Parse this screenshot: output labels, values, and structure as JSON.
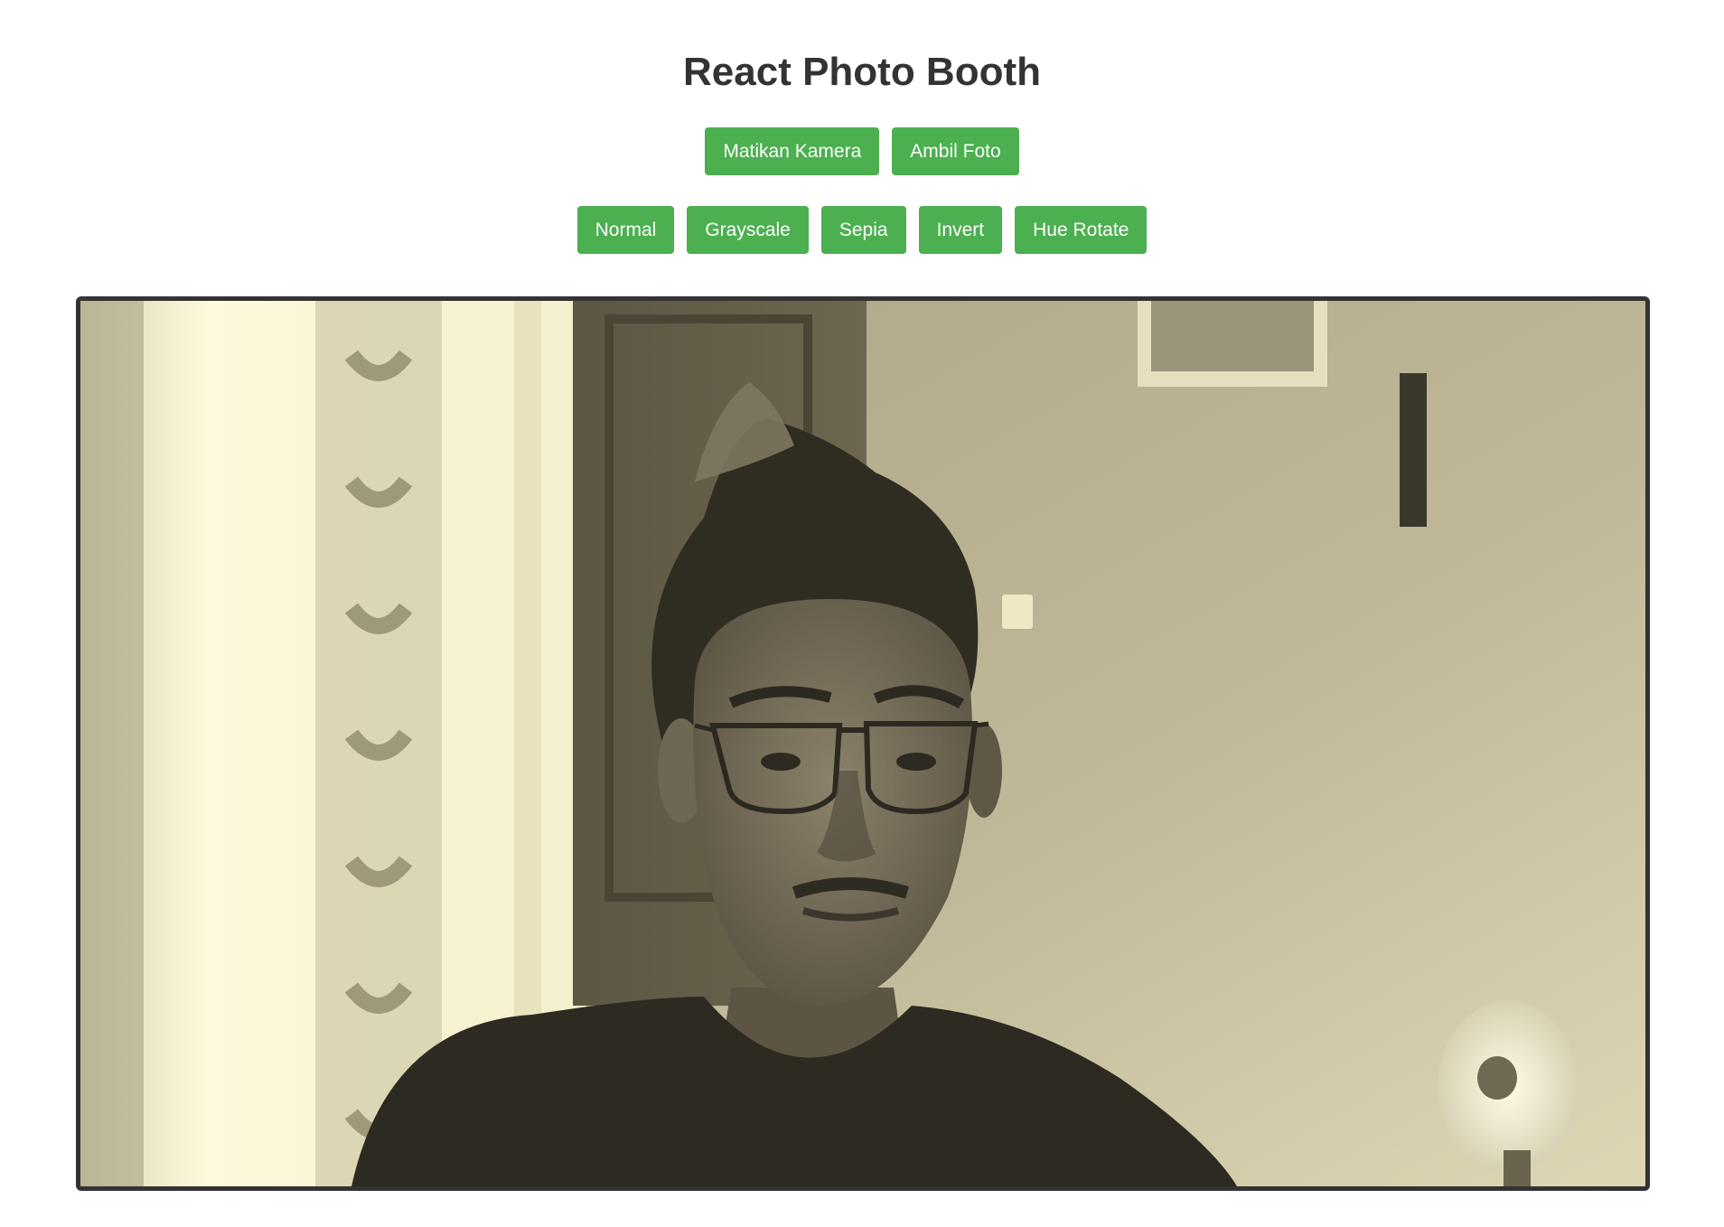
{
  "app": {
    "title": "React Photo Booth"
  },
  "camera_controls": {
    "toggle_camera_label": "Matikan Kamera",
    "take_photo_label": "Ambil Foto"
  },
  "filters": [
    {
      "label": "Normal"
    },
    {
      "label": "Grayscale"
    },
    {
      "label": "Sepia"
    },
    {
      "label": "Invert"
    },
    {
      "label": "Hue Rotate"
    }
  ],
  "camera": {
    "active_filter": "Sepia",
    "status": "on"
  },
  "colors": {
    "button_bg": "#4caf50",
    "button_text": "#ffffff",
    "title_text": "#333333",
    "frame_border": "#333333"
  }
}
